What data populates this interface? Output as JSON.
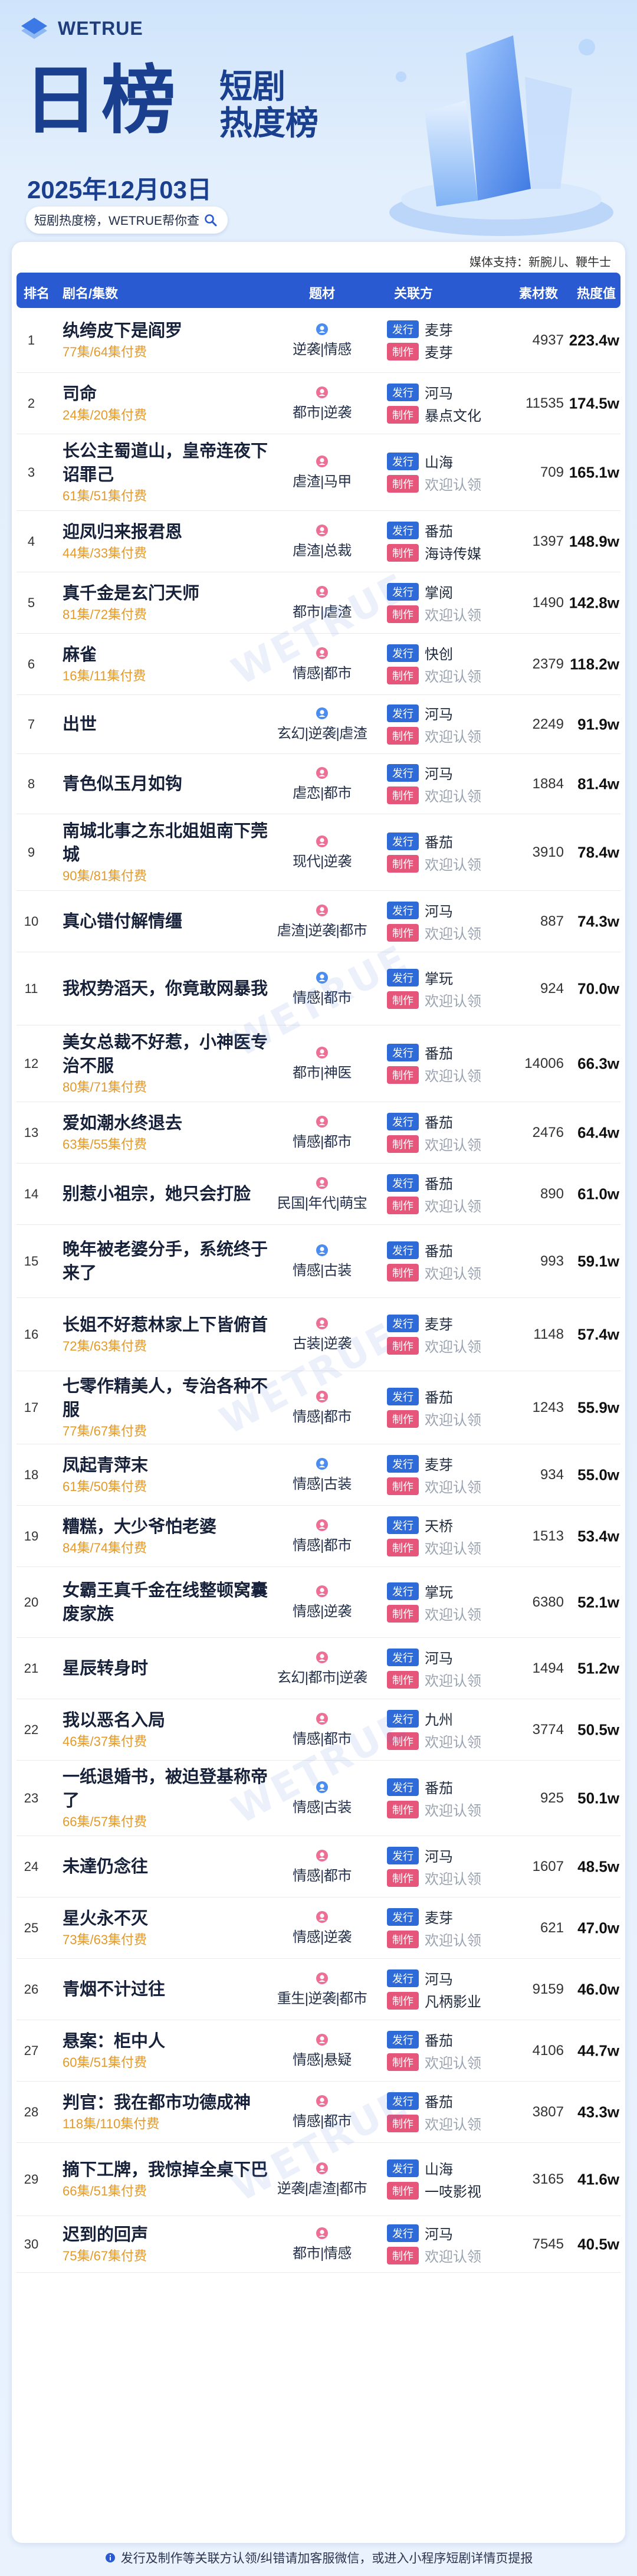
{
  "header": {
    "logo_text": "WETRUE",
    "title_main": "日榜",
    "title_line1": "短剧",
    "title_line2": "热度榜",
    "date": "2025年12月03日",
    "pill_text": "短剧热度榜，WETRUE帮你查"
  },
  "media_support": "媒体支持：新腕儿、鞭牛士",
  "table": {
    "headers": {
      "rank": "排名",
      "drama": "剧名/集数",
      "genre": "题材",
      "party": "关联方",
      "count": "素材数",
      "heat": "热度值"
    },
    "tag_issue": "发行",
    "tag_produce": "制作",
    "rows": [
      {
        "rank": "1",
        "name": "纨绔皮下是阎罗",
        "episodes": "77集/64集付费",
        "genre": "逆袭|情感",
        "gicon": "blue",
        "issuer": "麦芽",
        "producer": "麦芽",
        "count": "4937",
        "heat": "223.4w"
      },
      {
        "rank": "2",
        "name": "司命",
        "episodes": "24集/20集付费",
        "genre": "都市|逆袭",
        "gicon": "pink",
        "issuer": "河马",
        "producer": "暴点文化",
        "count": "11535",
        "heat": "174.5w"
      },
      {
        "rank": "3",
        "name": "长公主蜀道山，皇帝连夜下诏罪己",
        "episodes": "61集/51集付费",
        "genre": "虐渣|马甲",
        "gicon": "pink",
        "issuer": "山海",
        "producer": "欢迎认领",
        "count": "709",
        "heat": "165.1w"
      },
      {
        "rank": "4",
        "name": "迎凤归来报君恩",
        "episodes": "44集/33集付费",
        "genre": "虐渣|总裁",
        "gicon": "pink",
        "issuer": "番茄",
        "producer": "海诗传媒",
        "count": "1397",
        "heat": "148.9w"
      },
      {
        "rank": "5",
        "name": "真千金是玄门天师",
        "episodes": "81集/72集付费",
        "genre": "都市|虐渣",
        "gicon": "pink",
        "issuer": "掌阅",
        "producer": "欢迎认领",
        "count": "1490",
        "heat": "142.8w"
      },
      {
        "rank": "6",
        "name": "麻雀",
        "episodes": "16集/11集付费",
        "genre": "情感|都市",
        "gicon": "pink",
        "issuer": "快创",
        "producer": "欢迎认领",
        "count": "2379",
        "heat": "118.2w"
      },
      {
        "rank": "7",
        "name": "出世",
        "episodes": "",
        "genre": "玄幻|逆袭|虐渣",
        "gicon": "blue",
        "issuer": "河马",
        "producer": "欢迎认领",
        "count": "2249",
        "heat": "91.9w"
      },
      {
        "rank": "8",
        "name": "青色似玉月如钩",
        "episodes": "",
        "genre": "虐恋|都市",
        "gicon": "pink",
        "issuer": "河马",
        "producer": "欢迎认领",
        "count": "1884",
        "heat": "81.4w"
      },
      {
        "rank": "9",
        "name": "南城北事之东北姐姐南下莞城",
        "episodes": "90集/81集付费",
        "genre": "现代|逆袭",
        "gicon": "pink",
        "issuer": "番茄",
        "producer": "欢迎认领",
        "count": "3910",
        "heat": "78.4w"
      },
      {
        "rank": "10",
        "name": "真心错付解情缰",
        "episodes": "",
        "genre": "虐渣|逆袭|都市",
        "gicon": "pink",
        "issuer": "河马",
        "producer": "欢迎认领",
        "count": "887",
        "heat": "74.3w"
      },
      {
        "rank": "11",
        "name": "我权势滔天，你竟敢网暴我",
        "episodes": "",
        "genre": "情感|都市",
        "gicon": "blue",
        "issuer": "掌玩",
        "producer": "欢迎认领",
        "count": "924",
        "heat": "70.0w"
      },
      {
        "rank": "12",
        "name": "美女总裁不好惹，小神医专治不服",
        "episodes": "80集/71集付费",
        "genre": "都市|神医",
        "gicon": "pink",
        "issuer": "番茄",
        "producer": "欢迎认领",
        "count": "14006",
        "heat": "66.3w"
      },
      {
        "rank": "13",
        "name": "爱如潮水终退去",
        "episodes": "63集/55集付费",
        "genre": "情感|都市",
        "gicon": "pink",
        "issuer": "番茄",
        "producer": "欢迎认领",
        "count": "2476",
        "heat": "64.4w"
      },
      {
        "rank": "14",
        "name": "别惹小祖宗，她只会打脸",
        "episodes": "",
        "genre": "民国|年代|萌宝",
        "gicon": "pink",
        "issuer": "番茄",
        "producer": "欢迎认领",
        "count": "890",
        "heat": "61.0w"
      },
      {
        "rank": "15",
        "name": "晚年被老婆分手，系统终于来了",
        "episodes": "",
        "genre": "情感|古装",
        "gicon": "blue",
        "issuer": "番茄",
        "producer": "欢迎认领",
        "count": "993",
        "heat": "59.1w"
      },
      {
        "rank": "16",
        "name": "长姐不好惹林家上下皆俯首",
        "episodes": "72集/63集付费",
        "genre": "古装|逆袭",
        "gicon": "pink",
        "issuer": "麦芽",
        "producer": "欢迎认领",
        "count": "1148",
        "heat": "57.4w"
      },
      {
        "rank": "17",
        "name": "七零作精美人，专治各种不服",
        "episodes": "77集/67集付费",
        "genre": "情感|都市",
        "gicon": "pink",
        "issuer": "番茄",
        "producer": "欢迎认领",
        "count": "1243",
        "heat": "55.9w"
      },
      {
        "rank": "18",
        "name": "凤起青萍末",
        "episodes": "61集/50集付费",
        "genre": "情感|古装",
        "gicon": "blue",
        "issuer": "麦芽",
        "producer": "欢迎认领",
        "count": "934",
        "heat": "55.0w"
      },
      {
        "rank": "19",
        "name": "糟糕，大少爷怕老婆",
        "episodes": "84集/74集付费",
        "genre": "情感|都市",
        "gicon": "pink",
        "issuer": "天桥",
        "producer": "欢迎认领",
        "count": "1513",
        "heat": "53.4w"
      },
      {
        "rank": "20",
        "name": "女霸王真千金在线整顿窝囊废家族",
        "episodes": "",
        "genre": "情感|逆袭",
        "gicon": "pink",
        "issuer": "掌玩",
        "producer": "欢迎认领",
        "count": "6380",
        "heat": "52.1w"
      },
      {
        "rank": "21",
        "name": "星辰转身时",
        "episodes": "",
        "genre": "玄幻|都市|逆袭",
        "gicon": "pink",
        "issuer": "河马",
        "producer": "欢迎认领",
        "count": "1494",
        "heat": "51.2w"
      },
      {
        "rank": "22",
        "name": "我以恶名入局",
        "episodes": "46集/37集付费",
        "genre": "情感|都市",
        "gicon": "pink",
        "issuer": "九州",
        "producer": "欢迎认领",
        "count": "3774",
        "heat": "50.5w"
      },
      {
        "rank": "23",
        "name": "一纸退婚书，被迫登基称帝了",
        "episodes": "66集/57集付费",
        "genre": "情感|古装",
        "gicon": "blue",
        "issuer": "番茄",
        "producer": "欢迎认领",
        "count": "925",
        "heat": "50.1w"
      },
      {
        "rank": "24",
        "name": "未達仍念往",
        "episodes": "",
        "genre": "情感|都市",
        "gicon": "pink",
        "issuer": "河马",
        "producer": "欢迎认领",
        "count": "1607",
        "heat": "48.5w"
      },
      {
        "rank": "25",
        "name": "星火永不灭",
        "episodes": "73集/63集付费",
        "genre": "情感|逆袭",
        "gicon": "pink",
        "issuer": "麦芽",
        "producer": "欢迎认领",
        "count": "621",
        "heat": "47.0w"
      },
      {
        "rank": "26",
        "name": "青烟不计过往",
        "episodes": "",
        "genre": "重生|逆袭|都市",
        "gicon": "pink",
        "issuer": "河马",
        "producer": "凡柄影业",
        "count": "9159",
        "heat": "46.0w"
      },
      {
        "rank": "27",
        "name": "悬案：柜中人",
        "episodes": "60集/51集付费",
        "genre": "情感|悬疑",
        "gicon": "pink",
        "issuer": "番茄",
        "producer": "欢迎认领",
        "count": "4106",
        "heat": "44.7w"
      },
      {
        "rank": "28",
        "name": "判官：我在都市功德成神",
        "episodes": "118集/110集付费",
        "genre": "情感|都市",
        "gicon": "pink",
        "issuer": "番茄",
        "producer": "欢迎认领",
        "count": "3807",
        "heat": "43.3w"
      },
      {
        "rank": "29",
        "name": "摘下工牌，我惊掉全桌下巴",
        "episodes": "66集/51集付费",
        "genre": "逆袭|虐渣|都市",
        "gicon": "pink",
        "issuer": "山海",
        "producer": "一吱影视",
        "count": "3165",
        "heat": "41.6w"
      },
      {
        "rank": "30",
        "name": "迟到的回声",
        "episodes": "75集/67集付费",
        "genre": "都市|情感",
        "gicon": "pink",
        "issuer": "河马",
        "producer": "欢迎认领",
        "count": "7545",
        "heat": "40.5w"
      }
    ]
  },
  "watermark": "WETRUE",
  "footer": "发行及制作等关联方认领/纠错请加客服微信，或进入小程序短剧详情页提报",
  "colors": {
    "primary": "#2a5ad2",
    "issue_tag": "#2f6bd8",
    "produce_tag": "#e5567a",
    "episodes": "#e39a2b",
    "title": "#1a3f8f"
  }
}
